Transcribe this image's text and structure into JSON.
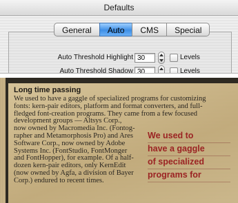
{
  "window": {
    "title": "Defaults",
    "tabs": [
      {
        "label": "General",
        "active": false
      },
      {
        "label": "Auto",
        "active": true
      },
      {
        "label": "CMS",
        "active": false
      },
      {
        "label": "Special",
        "active": false
      }
    ],
    "rows": [
      {
        "label": "Auto Threshold Highlight",
        "value": "30",
        "checkbox_label": "Levels",
        "checked": false
      },
      {
        "label": "Auto Threshold Shadow",
        "value": "30",
        "checkbox_label": "Levels",
        "checked": false
      }
    ]
  },
  "clipping": {
    "headline": "Long time passing",
    "lines": [
      "We used to have a gaggle of specialized programs for customizing",
      "fonts: kern-pair editors, platform and format converters, and full-",
      "fledged font-creation programs. They came from a few focused",
      "development groups — Altsys Corp.,",
      "now owned by Macromedia Inc. (Fontog-",
      "rapher and Metamorphosis Pro) and Ares",
      "Software Corp., now owned by Adobe",
      "Systems Inc. (FontStudio, FontMonger",
      "and FontHopper), for example. Of a half-",
      "dozen kern-pair editors, only KernEdit",
      "(now owned by Agfa, a division of Bayer",
      "Corp.) endured to recent times."
    ],
    "pullquote": [
      "We used to",
      "have a gaggle",
      "of specialized",
      "programs for"
    ]
  }
}
